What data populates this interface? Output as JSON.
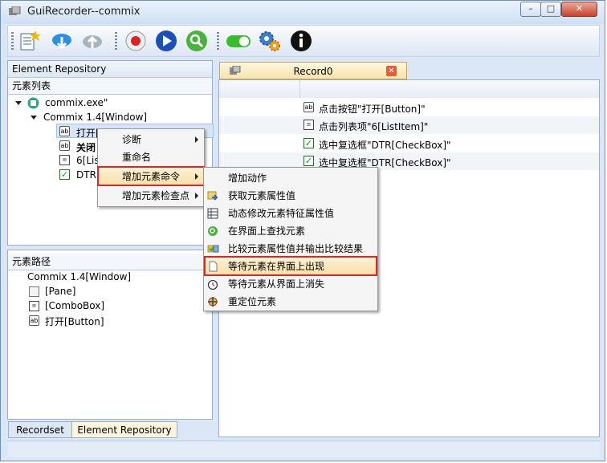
{
  "window": {
    "title": "GuiRecorder--commix",
    "controls": {
      "minimize": "–",
      "maximize": "□",
      "close": "✕"
    }
  },
  "toolbar": {
    "icons": [
      "new-record-icon",
      "download-icon",
      "upload-icon",
      "record-icon",
      "play-icon",
      "search-icon",
      "toggle-icon",
      "settings-icon",
      "info-icon"
    ]
  },
  "left_panel": {
    "header": "Element Repository",
    "list_label": "元素列表",
    "tree": {
      "root": "commix.exe\"",
      "window": "Commix 1.4[Window]",
      "children": [
        "打开[Button]",
        "关闭",
        "6[Lis",
        "DTR"
      ]
    },
    "path_label": "元素路径",
    "path": [
      "Commix 1.4[Window]",
      "[Pane]",
      "[ComboBox]",
      "打开[Button]"
    ],
    "tabs": [
      "Recordset",
      "Element Repository"
    ]
  },
  "record": {
    "tab_title": "Record0",
    "rows": [
      "点击按钮\"打开[Button]\"",
      "点击列表项\"6[ListItem]\"",
      "选中复选框\"DTR[CheckBox]\"",
      "选中复选框\"DTR[CheckBox]\""
    ]
  },
  "context_menu": {
    "items": [
      "诊断",
      "重命名",
      "增加元素命令",
      "增加元素检查点"
    ]
  },
  "submenu": {
    "items": [
      "增加动作",
      "获取元素属性值",
      "动态修改元素特征属性值",
      "在界面上查找元素",
      "比较元素属性值并输出比较结果",
      "等待元素在界面上出现",
      "等待元素从界面上消失",
      "重定位元素"
    ]
  },
  "colors": {
    "accent_red": "#d8262a",
    "highlight": "#f8dfa5",
    "title_bg": "#dbe7f6"
  }
}
